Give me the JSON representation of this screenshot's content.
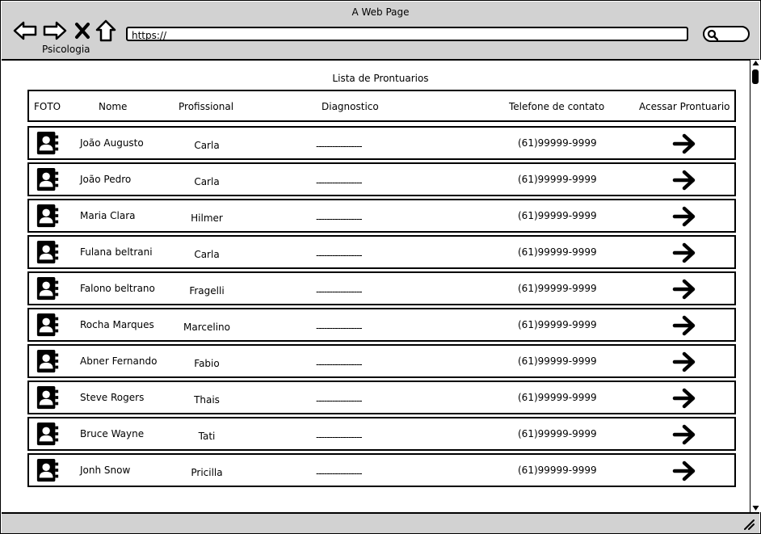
{
  "window": {
    "title": "A Web Page",
    "app_label": "Psicologia"
  },
  "address_bar": {
    "url": "https://"
  },
  "list": {
    "title": "Lista de Prontuarios",
    "headers": {
      "foto": "FOTO",
      "nome": "Nome",
      "profissional": "Profissional",
      "diagnostico": "Diagnostico",
      "telefone": "Telefone de contato",
      "acessar": "Acessar Prontuario"
    },
    "rows": [
      {
        "nome": "João Augusto",
        "profissional": "Carla",
        "diagnostico": "-----------------",
        "telefone": "(61)99999-9999"
      },
      {
        "nome": "João Pedro",
        "profissional": "Carla",
        "diagnostico": "-----------------",
        "telefone": "(61)99999-9999"
      },
      {
        "nome": "Maria Clara",
        "profissional": "Hilmer",
        "diagnostico": "-----------------",
        "telefone": "(61)99999-9999"
      },
      {
        "nome": "Fulana beltrani",
        "profissional": "Carla",
        "diagnostico": "-----------------",
        "telefone": "(61)99999-9999"
      },
      {
        "nome": "Falono beltrano",
        "profissional": "Fragelli",
        "diagnostico": "-----------------",
        "telefone": "(61)99999-9999"
      },
      {
        "nome": "Rocha Marques",
        "profissional": "Marcelino",
        "diagnostico": "-----------------",
        "telefone": "(61)99999-9999"
      },
      {
        "nome": "Abner Fernando",
        "profissional": "Fabio",
        "diagnostico": "-----------------",
        "telefone": "(61)99999-9999"
      },
      {
        "nome": "Steve Rogers",
        "profissional": "Thais",
        "diagnostico": "-----------------",
        "telefone": "(61)99999-9999"
      },
      {
        "nome": "Bruce Wayne",
        "profissional": "Tati",
        "diagnostico": "-----------------",
        "telefone": "(61)99999-9999"
      },
      {
        "nome": "Jonh Snow",
        "profissional": "Pricilla",
        "diagnostico": "-----------------",
        "telefone": "(61)99999-9999"
      }
    ]
  },
  "icons": {
    "back": "arrow-left-icon",
    "forward": "arrow-right-icon",
    "stop": "close-icon",
    "home": "home-icon",
    "search": "search-icon",
    "avatar": "contact-book-icon",
    "open": "arrow-right-icon"
  },
  "colors": {
    "chrome": "#d2d2d2",
    "border": "#000000",
    "background": "#ffffff"
  }
}
